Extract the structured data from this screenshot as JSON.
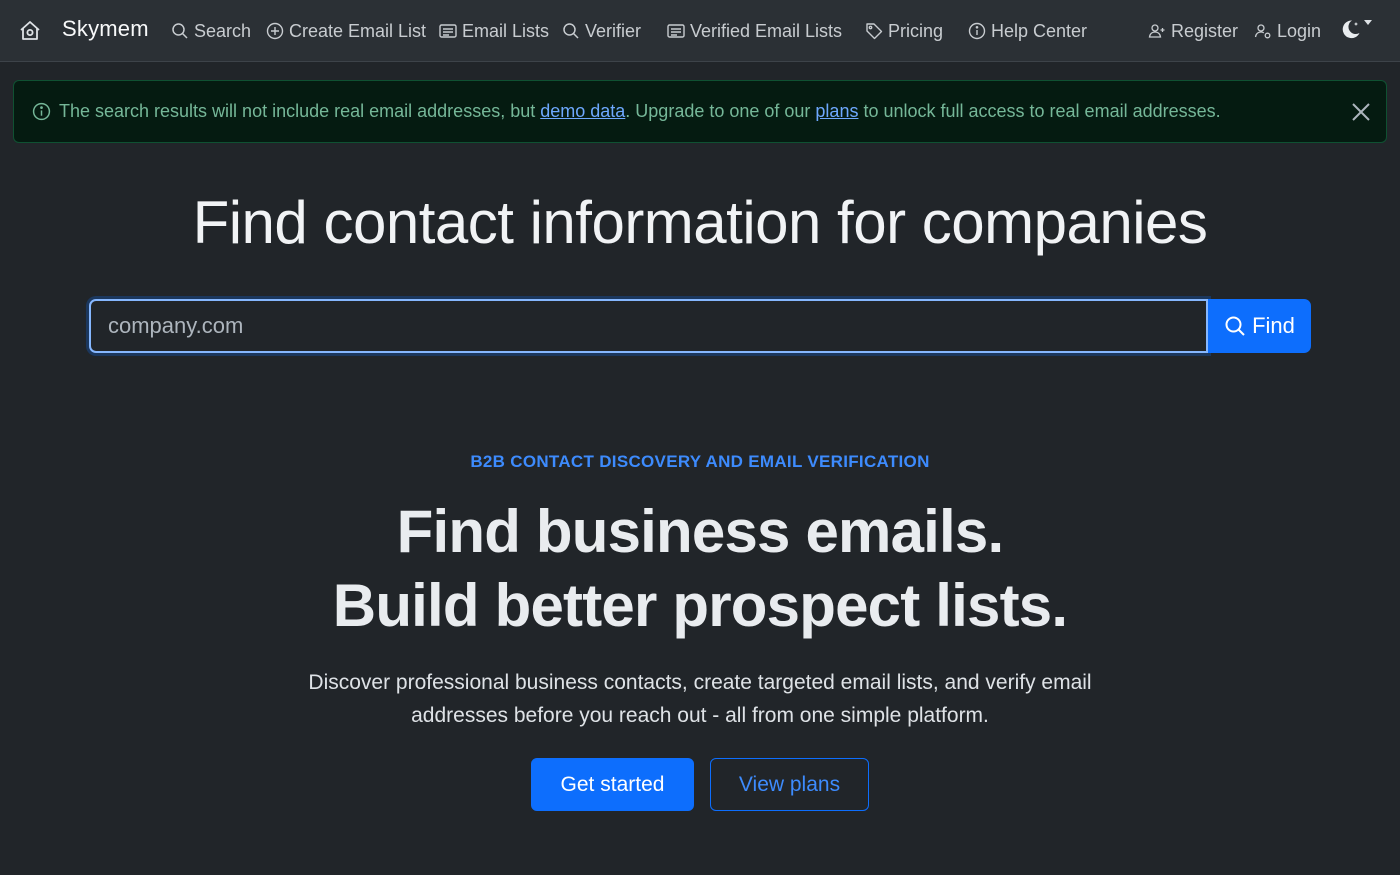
{
  "nav": {
    "brand": "Skymem",
    "home_icon": "home-icon",
    "items": [
      {
        "label": "Search",
        "icon": "search-icon"
      },
      {
        "label": "Create Email List",
        "icon": "plus-circle-icon"
      },
      {
        "label": "Email Lists",
        "icon": "list-icon"
      },
      {
        "label": "Verifier",
        "icon": "search-icon"
      },
      {
        "label": "Verified Email Lists",
        "icon": "list-icon"
      },
      {
        "label": "Pricing",
        "icon": "tag-icon"
      },
      {
        "label": "Help Center",
        "icon": "info-icon"
      }
    ],
    "register": "Register",
    "login": "Login",
    "theme_icon": "moon-icon"
  },
  "alert": {
    "text_before": "The search results will not include real email addresses, but ",
    "link1": "demo data",
    "text_middle": ". Upgrade to one of our ",
    "link2": "plans",
    "text_after": " to unlock full access to real email addresses.",
    "icon": "info-icon"
  },
  "hero": {
    "title": "Find contact information for companies",
    "search_placeholder": "company.com",
    "search_value": "",
    "find_label": "Find"
  },
  "marketing": {
    "eyebrow": "B2B CONTACT DISCOVERY AND EMAIL VERIFICATION",
    "headline_line1": "Find business emails.",
    "headline_line2": "Build better prospect lists.",
    "lead": "Discover professional business contacts, create targeted email lists, and verify email addresses before you reach out - all from one simple platform.",
    "cta_primary": "Get started",
    "cta_secondary": "View plans"
  },
  "colors": {
    "background": "#212529",
    "navbar": "#2b3035",
    "accent": "#0d6efd",
    "alert_bg": "#051b11",
    "alert_text": "#75b798"
  }
}
